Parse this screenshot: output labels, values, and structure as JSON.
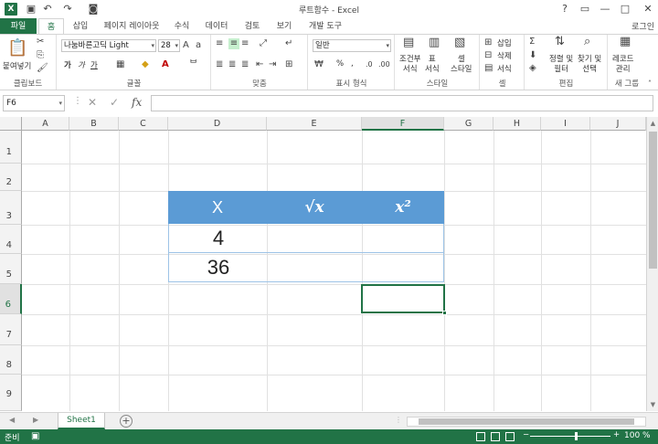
{
  "window": {
    "title": "루트함수 - Excel",
    "login": "로그인",
    "logo": "X",
    "qat": [
      "save-icon",
      "undo-icon",
      "redo-icon",
      "camera-icon"
    ],
    "controls": [
      "?",
      "▭",
      "—",
      "□",
      "✕"
    ]
  },
  "tabs": [
    {
      "label": "파일"
    },
    {
      "label": "홈"
    },
    {
      "label": "삽입"
    },
    {
      "label": "페이지 레이아웃"
    },
    {
      "label": "수식"
    },
    {
      "label": "데이터"
    },
    {
      "label": "검토"
    },
    {
      "label": "보기"
    },
    {
      "label": "개발 도구"
    }
  ],
  "ribbon": {
    "clipboard": {
      "label": "클립보드",
      "paste": "붙여넣기"
    },
    "font": {
      "label": "글꼴",
      "name": "나눔바른고딕 Light",
      "size": "28",
      "bold": "가",
      "italic": "가",
      "underline": "가"
    },
    "align": {
      "label": "맞춤"
    },
    "number": {
      "label": "표시 형식",
      "format": "일반",
      "percent": "%",
      "comma": ","
    },
    "styles": {
      "label": "스타일",
      "conditional": "조건부\n서식",
      "table": "표\n서식",
      "cell": "셀\n스타일"
    },
    "cells": {
      "label": "셀",
      "insert": "삽입",
      "delete": "삭제",
      "format": "서식"
    },
    "editing": {
      "label": "편집",
      "sort": "정렬 및\n필터",
      "find": "찾기 및\n선택"
    },
    "new_group": {
      "label": "새 그룹",
      "record": "레코드\n관리"
    }
  },
  "formula_bar": {
    "name_box": "F6",
    "fx": "fx",
    "formula": ""
  },
  "grid": {
    "columns": [
      "A",
      "B",
      "C",
      "D",
      "E",
      "F",
      "G",
      "H",
      "I",
      "J"
    ],
    "rows": [
      "1",
      "2",
      "3",
      "4",
      "5",
      "6",
      "7",
      "8",
      "9"
    ],
    "selected_col": "F",
    "selected_row": "6"
  },
  "table": {
    "headers": [
      "X",
      "√x",
      "x²"
    ],
    "rows": [
      [
        "4",
        "",
        ""
      ],
      [
        "36",
        "",
        ""
      ]
    ],
    "header_color": "#5b9bd5",
    "border_color": "#9dc3e6"
  },
  "sheets": {
    "tabs": [
      "Sheet1"
    ],
    "add": "+"
  },
  "status": {
    "text": "준비",
    "zoom": "100 %",
    "zoom_minus": "−",
    "zoom_plus": "+"
  },
  "colors": {
    "accent": "#217346"
  }
}
